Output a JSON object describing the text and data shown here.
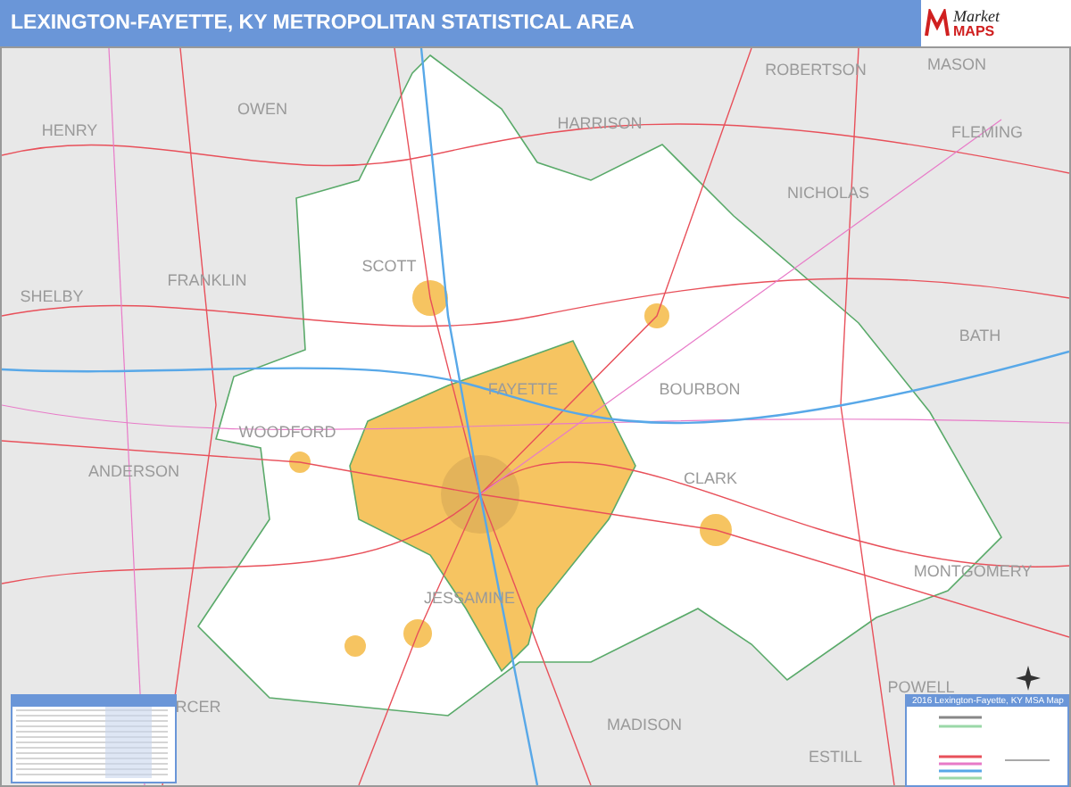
{
  "header": {
    "title": "LEXINGTON-FAYETTE, KY METROPOLITAN STATISTICAL AREA",
    "logo": {
      "name": "Market",
      "sub": "MAPS"
    }
  },
  "map": {
    "counties": [
      {
        "name": "ROBERTSON"
      },
      {
        "name": "MASON"
      },
      {
        "name": "OWEN"
      },
      {
        "name": "HENRY"
      },
      {
        "name": "HARRISON"
      },
      {
        "name": "FLEMING"
      },
      {
        "name": "NICHOLAS"
      },
      {
        "name": "FRANKLIN"
      },
      {
        "name": "SCOTT"
      },
      {
        "name": "SHELBY"
      },
      {
        "name": "BATH"
      },
      {
        "name": "FAYETTE"
      },
      {
        "name": "BOURBON"
      },
      {
        "name": "WOODFORD"
      },
      {
        "name": "ANDERSON"
      },
      {
        "name": "CLARK"
      },
      {
        "name": "MONTGOMERY"
      },
      {
        "name": "JESSAMINE"
      },
      {
        "name": "POWELL"
      },
      {
        "name": "RCER"
      },
      {
        "name": "MADISON"
      },
      {
        "name": "ESTILL"
      }
    ]
  },
  "legend": {
    "title": "2016 Lexington-Fayette, KY MSA Map"
  }
}
